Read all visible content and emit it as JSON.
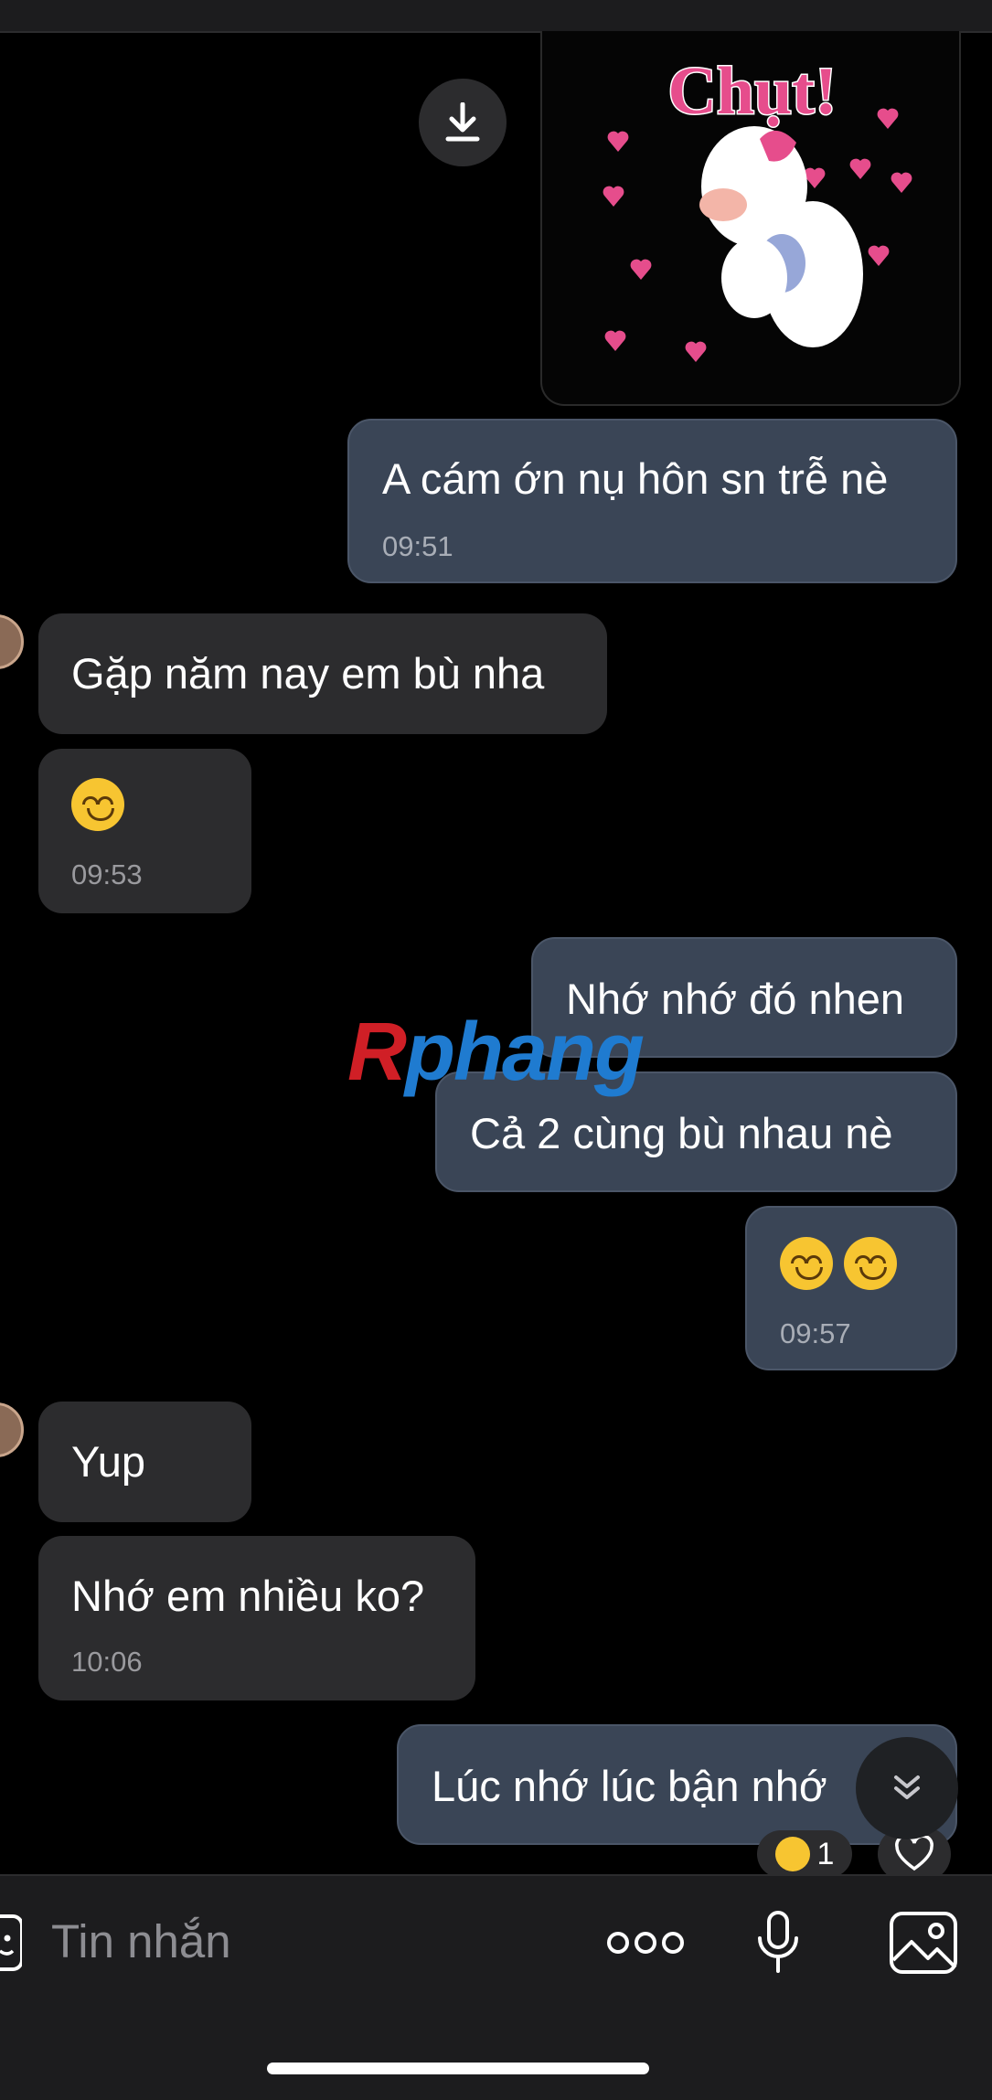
{
  "messages": {
    "m1": {
      "text": "A cám ớn nụ hôn sn trễ nè",
      "time": "09:51"
    },
    "m2": {
      "text": "Gặp năm nay em bù nha"
    },
    "m3": {
      "time": "09:53"
    },
    "m4": {
      "text": "Nhớ nhớ đó nhen"
    },
    "m5": {
      "text": "Cả 2 cùng bù nhau nè"
    },
    "m6": {
      "time": "09:57"
    },
    "m7": {
      "text": "Yup"
    },
    "m8": {
      "text": "Nhớ em nhiều ko?",
      "time": "10:06"
    },
    "m9": {
      "text": "Lúc nhớ lúc bận nhớ"
    }
  },
  "sticker": {
    "text": "Chụt!"
  },
  "reaction": {
    "count": "1"
  },
  "input": {
    "placeholder": "Tin nhắn"
  },
  "watermark": {
    "part1": "R",
    "part2": "phang"
  },
  "colors": {
    "background": "#000000",
    "outgoing_bubble": "#3a4556",
    "incoming_bubble": "#2c2c2e",
    "sticker_pink": "#e64d8c"
  },
  "icons": [
    "download-icon",
    "scroll-down-icon",
    "heart-icon",
    "more-icon",
    "mic-icon",
    "gallery-icon",
    "sticker-icon"
  ]
}
